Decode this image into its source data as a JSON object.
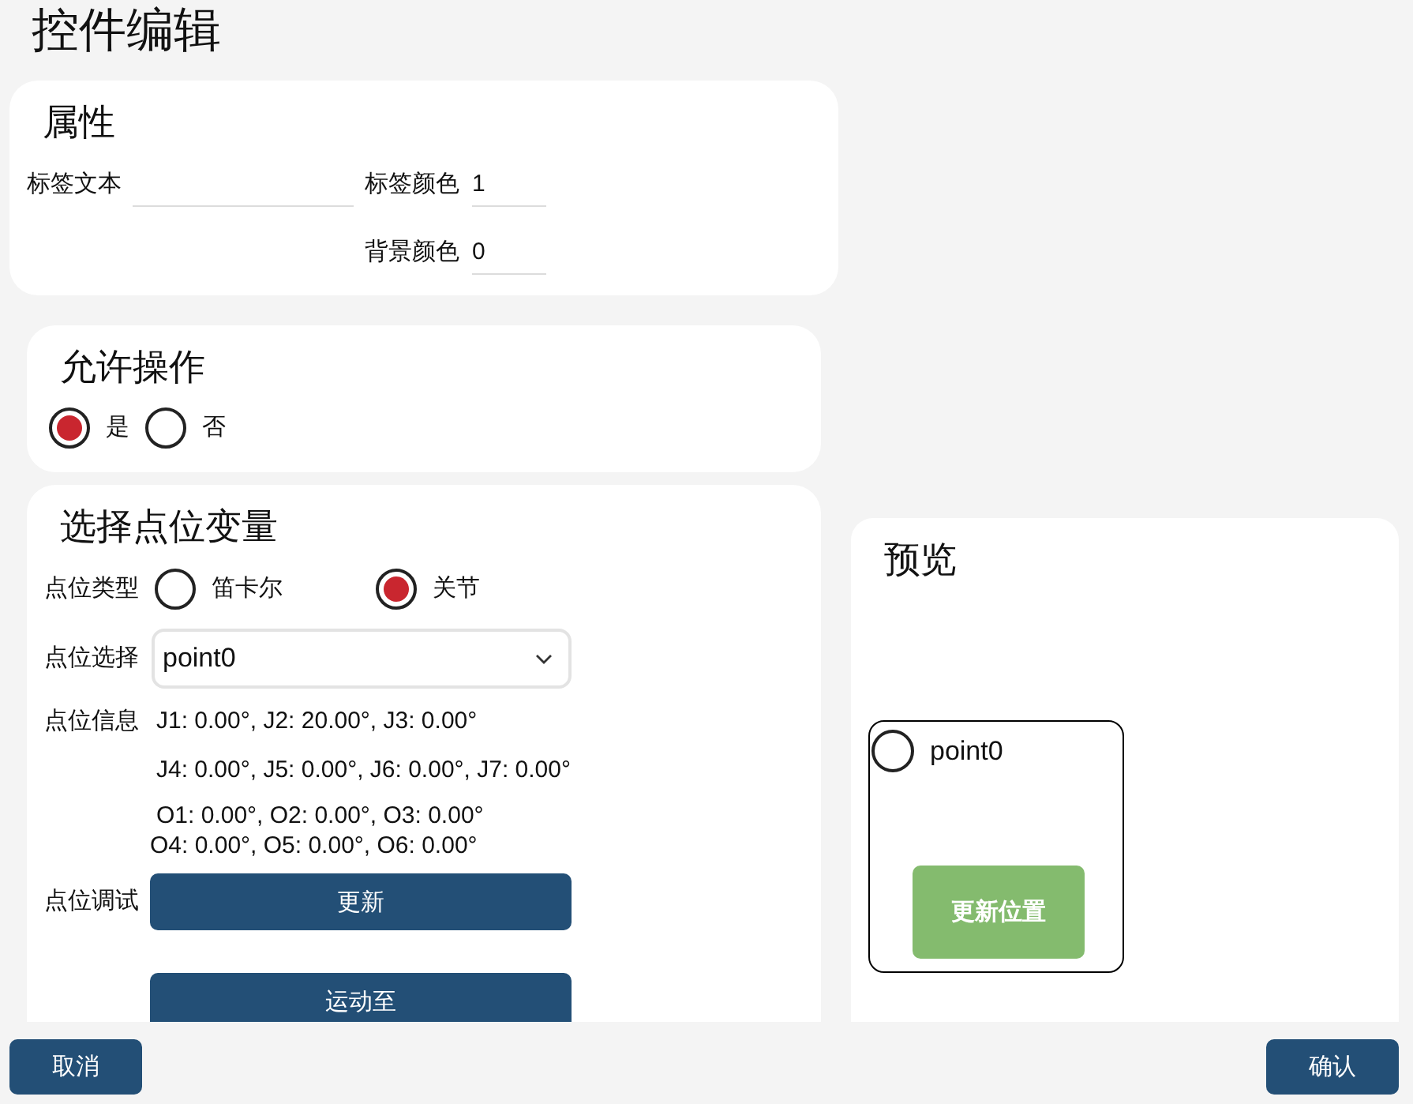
{
  "title": "控件编辑",
  "properties": {
    "title": "属性",
    "fields": [
      {
        "label": "标签文本"
      },
      {
        "label": "标签颜色",
        "value": "1"
      },
      {
        "label": "背景颜色",
        "value": "0"
      }
    ]
  },
  "allow_operation": {
    "title": "允许操作",
    "options": [
      {
        "label": "是",
        "selected": true
      },
      {
        "label": "否",
        "selected": false
      }
    ]
  },
  "point_variable": {
    "title": "选择点位变量",
    "point_type": {
      "label": "点位类型",
      "options": [
        {
          "label": "笛卡尔",
          "selected": false
        },
        {
          "label": "关节",
          "selected": true
        }
      ]
    },
    "point_select": {
      "label": "点位选择",
      "value": "point0"
    },
    "point_info": {
      "label": "点位信息",
      "joint_lines": [
        "J1: 0.00°, J2: 20.00°, J3: 0.00°",
        "J4: 0.00°, J5: 0.00°, J6: 0.00°, J7: 0.00°"
      ],
      "pose_lines": [
        "O1: 0.00°, O2: 0.00°, O3: 0.00°",
        "O4: 0.00°, O5: 0.00°, O6: 0.00°"
      ]
    },
    "point_debug": {
      "label": "点位调试",
      "buttons": [
        "更新",
        "运动至"
      ]
    }
  },
  "preview": {
    "title": "预览",
    "widget": {
      "label": "point0",
      "selected": false,
      "button": "更新位置"
    }
  },
  "footer": {
    "buttons": [
      "取消",
      "确认"
    ]
  }
}
